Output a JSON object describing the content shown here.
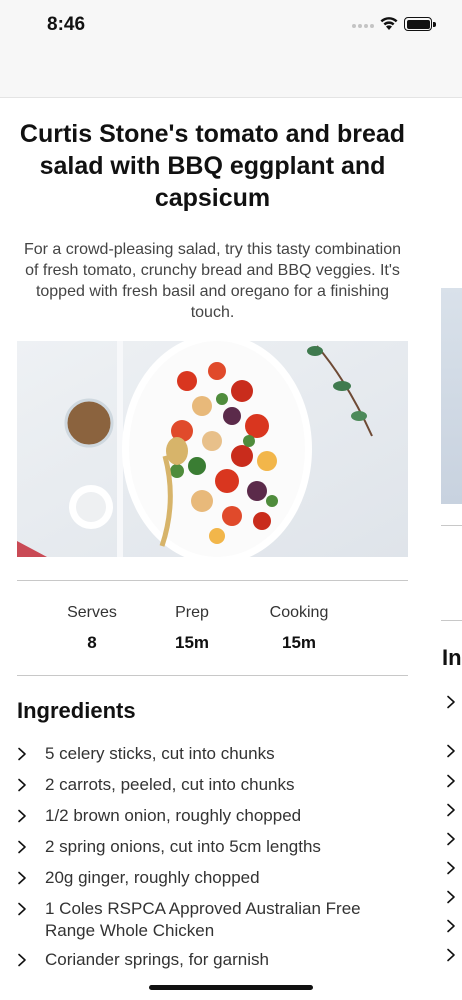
{
  "status_bar": {
    "time": "8:46"
  },
  "recipe": {
    "title": "Curtis Stone's tomato and bread salad with BBQ eggplant and capsicum",
    "description": "For a crowd-pleasing salad, try this tasty combination of fresh tomato, crunchy bread and BBQ veggies. It's topped with fresh basil and oregano for a finishing touch.",
    "stats": [
      {
        "label": "Serves",
        "value": "8"
      },
      {
        "label": "Prep",
        "value": "15m"
      },
      {
        "label": "Cooking",
        "value": "15m"
      }
    ],
    "ingredients_title": "Ingredients",
    "ingredients": [
      "5 celery sticks, cut into chunks",
      "2 carrots, peeled, cut into chunks",
      "1/2 brown onion, roughly chopped",
      "2 spring onions, cut into 5cm lengths",
      "20g ginger, roughly chopped",
      "1 Coles RSPCA Approved Australian Free Range Whole Chicken",
      "Coriander springs, for garnish"
    ]
  },
  "next_card": {
    "ingredients_title_partial": "In"
  },
  "icons": {
    "status": [
      "signal-dots-icon",
      "wifi-icon",
      "battery-icon"
    ],
    "list": "chevron-right-icon"
  },
  "colors": {
    "text": "#111111",
    "muted": "#444444",
    "divider": "#c8c8c8",
    "status_bg": "#f7f7f7"
  }
}
